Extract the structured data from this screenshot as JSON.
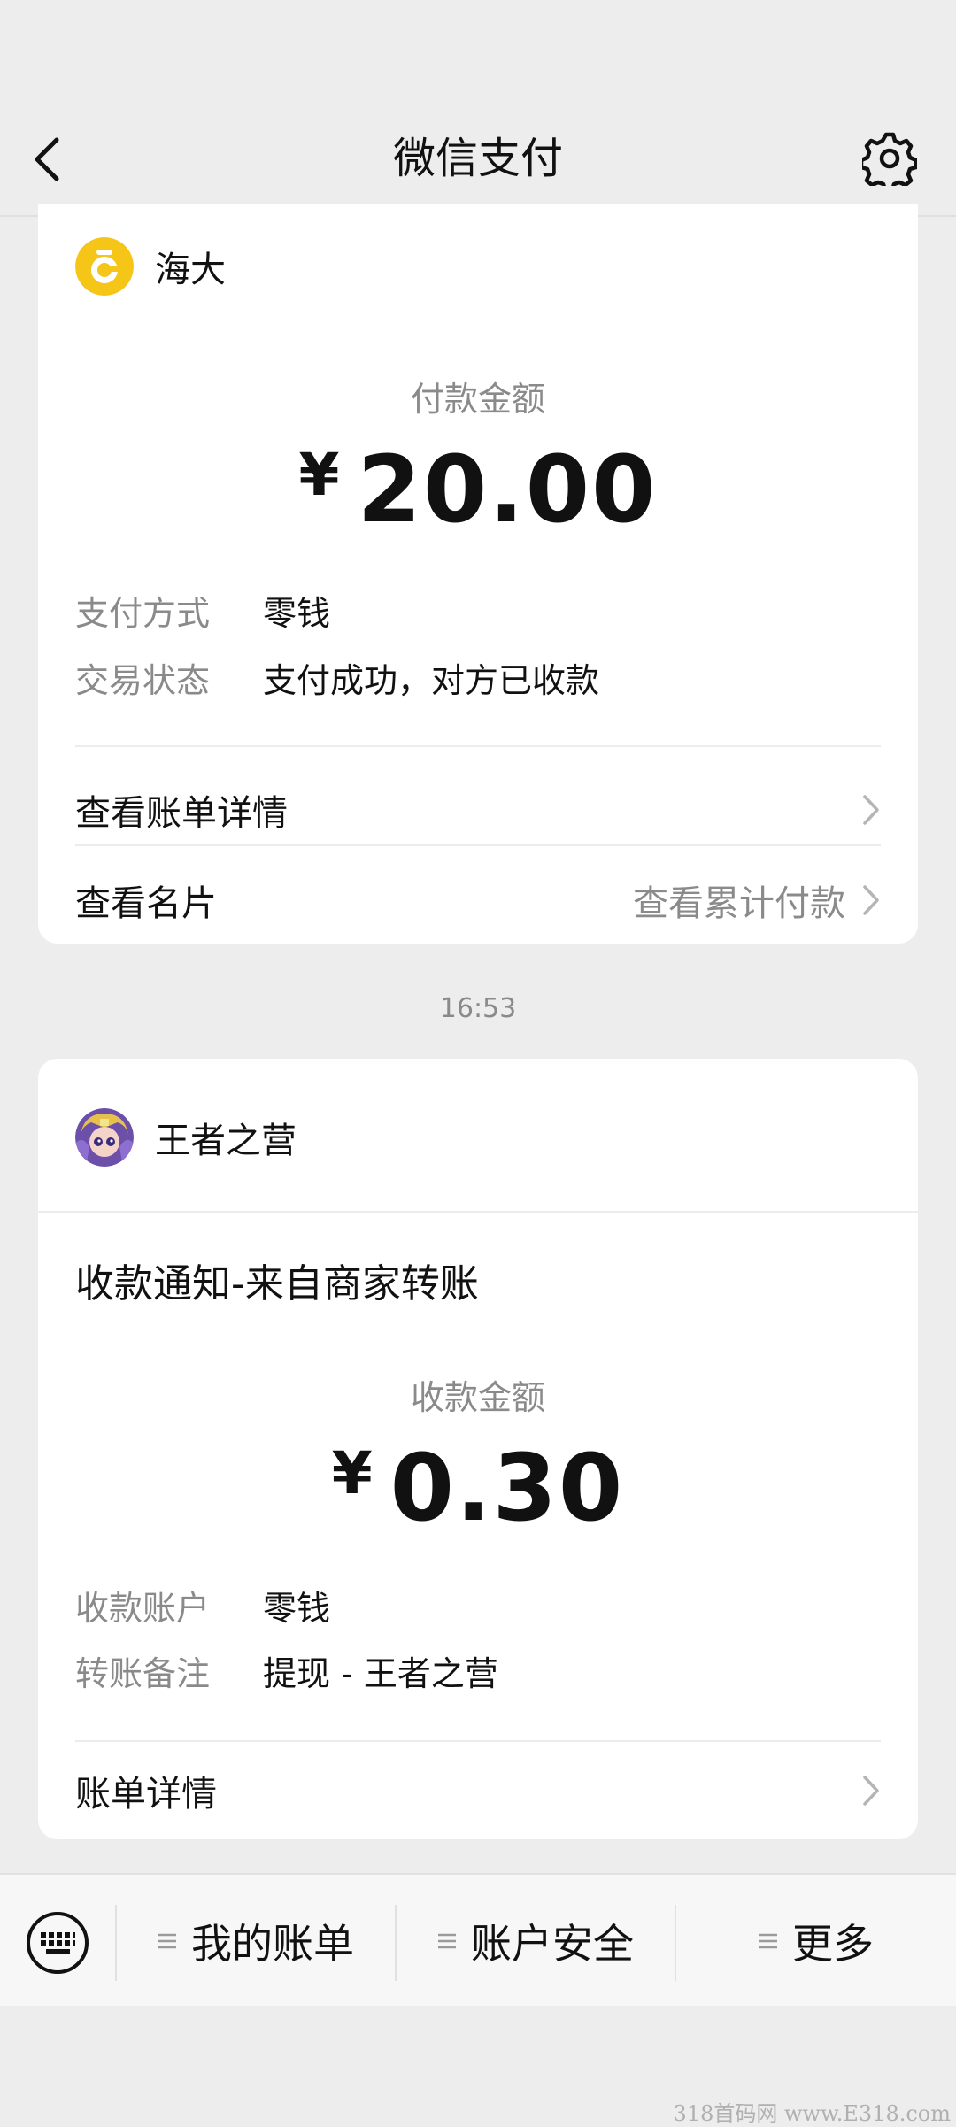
{
  "header": {
    "title": "微信支付",
    "back_icon": "chevron-left-icon",
    "settings_icon": "gear-icon"
  },
  "payment_card": {
    "merchant": "海大",
    "amount_label": "付款金额",
    "currency": "¥",
    "amount": "20.00",
    "rows": [
      {
        "label": "支付方式",
        "value": "零钱"
      },
      {
        "label": "交易状态",
        "value": "支付成功，对方已收款"
      }
    ],
    "bill_link": "查看账单详情",
    "card_link": "查看名片",
    "cumulative_link": "查看累计付款"
  },
  "timestamp": "16:53",
  "receipt_card": {
    "merchant": "王者之营",
    "notice_title": "收款通知-来自商家转账",
    "amount_label": "收款金额",
    "currency": "¥",
    "amount": "0.30",
    "rows": [
      {
        "label": "收款账户",
        "value": "零钱"
      },
      {
        "label": "转账备注",
        "value": "提现 - 王者之营"
      }
    ],
    "bill_link": "账单详情"
  },
  "bottom_menu": {
    "keyboard_icon": "keyboard-icon",
    "items": [
      {
        "label": "我的账单"
      },
      {
        "label": "账户安全"
      },
      {
        "label": "更多"
      }
    ]
  },
  "watermark": "318首码网 www.E318.com",
  "colors": {
    "background": "#ededed",
    "card": "#ffffff",
    "secondary_text": "#8a8a8a",
    "merchant_logo_yellow": "#f5c518"
  }
}
